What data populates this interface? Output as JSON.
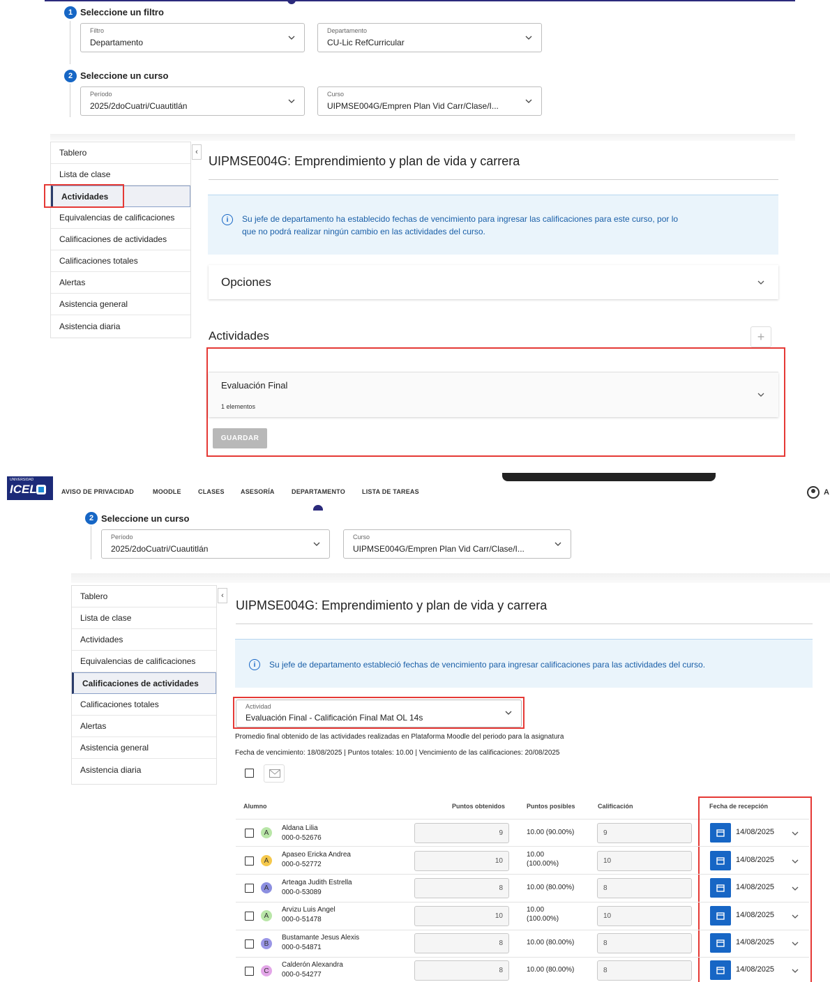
{
  "top": {
    "step1": {
      "num": "1",
      "title": "Seleccione un filtro"
    },
    "filtro": {
      "label": "Filtro",
      "value": "Departamento"
    },
    "departamento": {
      "label": "Departamento",
      "value": "CU-Lic RefCurricular"
    },
    "step2": {
      "num": "2",
      "title": "Seleccione un curso"
    },
    "periodo": {
      "label": "Período",
      "value": "2025/2doCuatri/Cuautitlán"
    },
    "curso": {
      "label": "Curso",
      "value": "UIPMSE004G/Empren Plan Vid Carr/Clase/I..."
    },
    "sidebar": [
      "Tablero",
      "Lista de clase",
      "Actividades",
      "Equivalencias de calificaciones",
      "Calificaciones de actividades",
      "Calificaciones totales",
      "Alertas",
      "Asistencia general",
      "Asistencia diaria"
    ],
    "course_title": "UIPMSE004G: Emprendimiento y plan de vida y carrera",
    "info_line1": "Su jefe de departamento ha establecido fechas de vencimiento para ingresar las calificaciones para este curso, por lo",
    "info_line2": "que no podrá realizar ningún cambio en las actividades del curso.",
    "opciones": "Opciones",
    "actividades_title": "Actividades",
    "add_label": "+",
    "eval_title": "Evaluación Final",
    "eval_count": "1 elementos",
    "save": "GUARDAR"
  },
  "nav": {
    "logo_top": "UNIVERSIDAD",
    "logo_main": "ICEL",
    "items": [
      "AVISO DE PRIVACIDAD",
      "MOODLE",
      "CLASES",
      "ASESORÍA",
      "DEPARTAMENTO",
      "LISTA DE TAREAS"
    ],
    "user_initial": "A"
  },
  "bottom": {
    "step2": {
      "num": "2",
      "title": "Seleccione un curso"
    },
    "periodo": {
      "label": "Período",
      "value": "2025/2doCuatri/Cuautitlán"
    },
    "curso": {
      "label": "Curso",
      "value": "UIPMSE004G/Empren Plan Vid Carr/Clase/I..."
    },
    "sidebar": [
      "Tablero",
      "Lista de clase",
      "Actividades",
      "Equivalencias de calificaciones",
      "Calificaciones de actividades",
      "Calificaciones totales",
      "Alertas",
      "Asistencia general",
      "Asistencia diaria"
    ],
    "course_title": "UIPMSE004G: Emprendimiento y plan de vida y carrera",
    "info": "Su jefe de departamento estableció fechas de vencimiento para ingresar calificaciones para las actividades del curso.",
    "actividad": {
      "label": "Actividad",
      "value": "Evaluación Final - Calificación Final Mat OL 14s"
    },
    "desc": "Promedio final obtenido de las actividades realizadas en Plataforma Moodle del periodo para la asignatura",
    "meta": "Fecha de vencimiento: 18/08/2025 | Puntos totales: 10.00 | Vencimiento de las calificaciones: 20/08/2025",
    "headers": {
      "alumno": "Alumno",
      "obtenidos": "Puntos obtenidos",
      "posibles": "Puntos posibles",
      "calificacion": "Calificación",
      "fecha": "Fecha de recepción"
    },
    "students": [
      {
        "initial": "A",
        "color": "#b9e6a8",
        "name": "Aldana Lilia",
        "id": "000-0-52676",
        "obtained": "9",
        "possible1": "10.00 (90.00%)",
        "possible2": "",
        "grade": "9",
        "date": "14/08/2025"
      },
      {
        "initial": "A",
        "color": "#f5c84c",
        "name": "Apaseo Ericka Andrea",
        "id": "000-0-52772",
        "obtained": "10",
        "possible1": "10.00",
        "possible2": "(100.00%)",
        "grade": "10",
        "date": "14/08/2025"
      },
      {
        "initial": "A",
        "color": "#8c8fe0",
        "name": "Arteaga Judith Estrella",
        "id": "000-0-53089",
        "obtained": "8",
        "possible1": "10.00 (80.00%)",
        "possible2": "",
        "grade": "8",
        "date": "14/08/2025"
      },
      {
        "initial": "A",
        "color": "#b9e6a8",
        "name": "Arvizu Luis Angel",
        "id": "000-0-51478",
        "obtained": "10",
        "possible1": "10.00",
        "possible2": "(100.00%)",
        "grade": "10",
        "date": "14/08/2025"
      },
      {
        "initial": "B",
        "color": "#9a96e6",
        "name": "Bustamante Jesus Alexis",
        "id": "000-0-54871",
        "obtained": "8",
        "possible1": "10.00 (80.00%)",
        "possible2": "",
        "grade": "8",
        "date": "14/08/2025"
      },
      {
        "initial": "C",
        "color": "#e3a6e8",
        "name": "Calderón Alexandra",
        "id": "000-0-54277",
        "obtained": "8",
        "possible1": "10.00 (80.00%)",
        "possible2": "",
        "grade": "8",
        "date": "14/08/2025"
      }
    ]
  }
}
